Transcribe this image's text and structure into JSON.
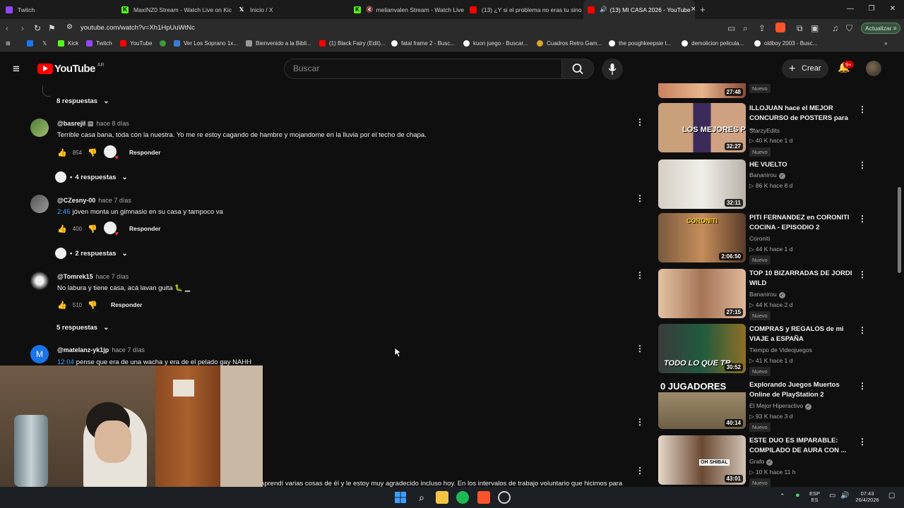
{
  "browser": {
    "tabs": [
      {
        "title": "Twitch",
        "active": false
      },
      {
        "title": "MaxiNZ0 Stream - Watch Live on Kic",
        "active": false
      },
      {
        "title": "Inicio / X",
        "active": false
      },
      {
        "title": "melianvalen Stream - Watch Live",
        "active": false
      },
      {
        "title": "(13) ¿Y si el problema no eras tu sino",
        "active": false
      },
      {
        "title": "(13) MI CASA 2026 - YouTube",
        "active": true
      }
    ],
    "url": "youtube.com/watch?v=Xh1HpUuWtNc",
    "update_label": "Actualizar",
    "bookmarks": [
      "Kick",
      "Twitch",
      "YouTube",
      "",
      "Ver Los Soprano 1x...",
      "Bienvenido a la Bibli...",
      "(1) Black Fairy (Edit)...",
      "fatal frame 2 - Busc...",
      "kuon juego - Buscar...",
      "Cuadros Retro Gam...",
      "the poughkeepsie t...",
      "demolicion pelicula...",
      "oldboy 2003 - Busc..."
    ]
  },
  "youtube": {
    "logo": "YouTube",
    "region": "AR",
    "search_placeholder": "Buscar",
    "create_label": "Crear",
    "notifications": "9+"
  },
  "comments": [
    {
      "replies_label": "8 respuestas"
    },
    {
      "author": "@basrejil",
      "time": "hace 8 días",
      "text": "Terrible casa bana, toda con la nuestra. Yo me re estoy cagando de hambre y mojandome en la lluvia por el techo de chapa.",
      "likes": "854",
      "reply_label": "Responder",
      "replies_label": "4 respuestas"
    },
    {
      "author": "@CZesny-00",
      "time": "hace 7 días",
      "timestamp": "2:46",
      "text": "jóven monta un gimnasio en su casa y tampoco va",
      "likes": "400",
      "reply_label": "Responder",
      "replies_label": "2 respuestas"
    },
    {
      "author": "@Tomrek15",
      "time": "hace 7 días",
      "text": "No labura y tiene casa, acá lavan guita 🐛 ▁",
      "likes": "510",
      "reply_label": "Responder",
      "replies_label": "5 respuestas"
    },
    {
      "author": "@matelanz-yk1jp",
      "time": "hace 7 días",
      "timestamp": "12:04",
      "text": "pense que era de una wacha y era de el pelado gay NAHH",
      "avatar_letter": "M"
    }
  ],
  "partial_comment_text": "Aprendí varias cosas de él y le estoy muy agradecido incluso hoy. En los intervalos de trabajo voluntario que hicimos para",
  "sidebar": [
    {
      "duration": "27:48",
      "badge": "Nuevo"
    },
    {
      "title": "ILLOJUAN hace el MEJOR CONCURSO de POSTERS para ...",
      "channel": "StarzyEdits",
      "verified": false,
      "stats": "▷ 40 K   hace 1 d",
      "duration": "32:27",
      "badge": "Nuevo",
      "thumb_text": "LOS MEJORES POST"
    },
    {
      "title": "HE VUELTO",
      "channel": "Bananirou",
      "verified": true,
      "stats": "▷ 86 K   hace 8 d",
      "duration": "32:11",
      "badge": ""
    },
    {
      "title": "PITI FERNANDEZ en CORONITI COCINA - EPISODIO 2",
      "channel": "Coroniti",
      "verified": false,
      "stats": "▷ 44 K   hace 1 d",
      "duration": "2:06:50",
      "badge": "Nuevo",
      "thumb_text": "CORONITI"
    },
    {
      "title": "TOP 10 BIZARRADAS DE JORDI WILD",
      "channel": "Bananirou",
      "verified": true,
      "stats": "▷ 44 K   hace 2 d",
      "duration": "27:15",
      "badge": "Nuevo"
    },
    {
      "title": "COMPRAS y REGALOS de mi VIAJE a ESPAÑA",
      "channel": "Tiempo de Videojuegos",
      "verified": false,
      "stats": "▷ 41 K   hace 1 d",
      "duration": "30:52",
      "badge": "Nuevo",
      "thumb_text": "TODO LO QUE TR"
    },
    {
      "title": "Explorando Juegos Muertos Online de PlayStation 2",
      "channel": "El Mejor Hiperactivo",
      "verified": true,
      "stats": "▷ 93 K   hace 3 d",
      "duration": "40:14",
      "badge": "Nuevo",
      "thumb_text": "0 JUGADORES"
    },
    {
      "title": "ESTE DUO ES IMPARABLE: COMPILADO DE AURA CON ...",
      "channel": "Grafo",
      "verified": true,
      "stats": "▷ 10 K   hace 11 h",
      "duration": "43:01",
      "badge": "Nuevo",
      "thumb_text": "OH SHIBAL"
    }
  ],
  "taskbar": {
    "lang": "ESP",
    "lang2": "ES",
    "time": "07:43",
    "date": "26/4/2026"
  },
  "colors": {
    "link": "#3ea6ff",
    "youtube_red": "#ff0000",
    "background": "#0f0f0f"
  }
}
